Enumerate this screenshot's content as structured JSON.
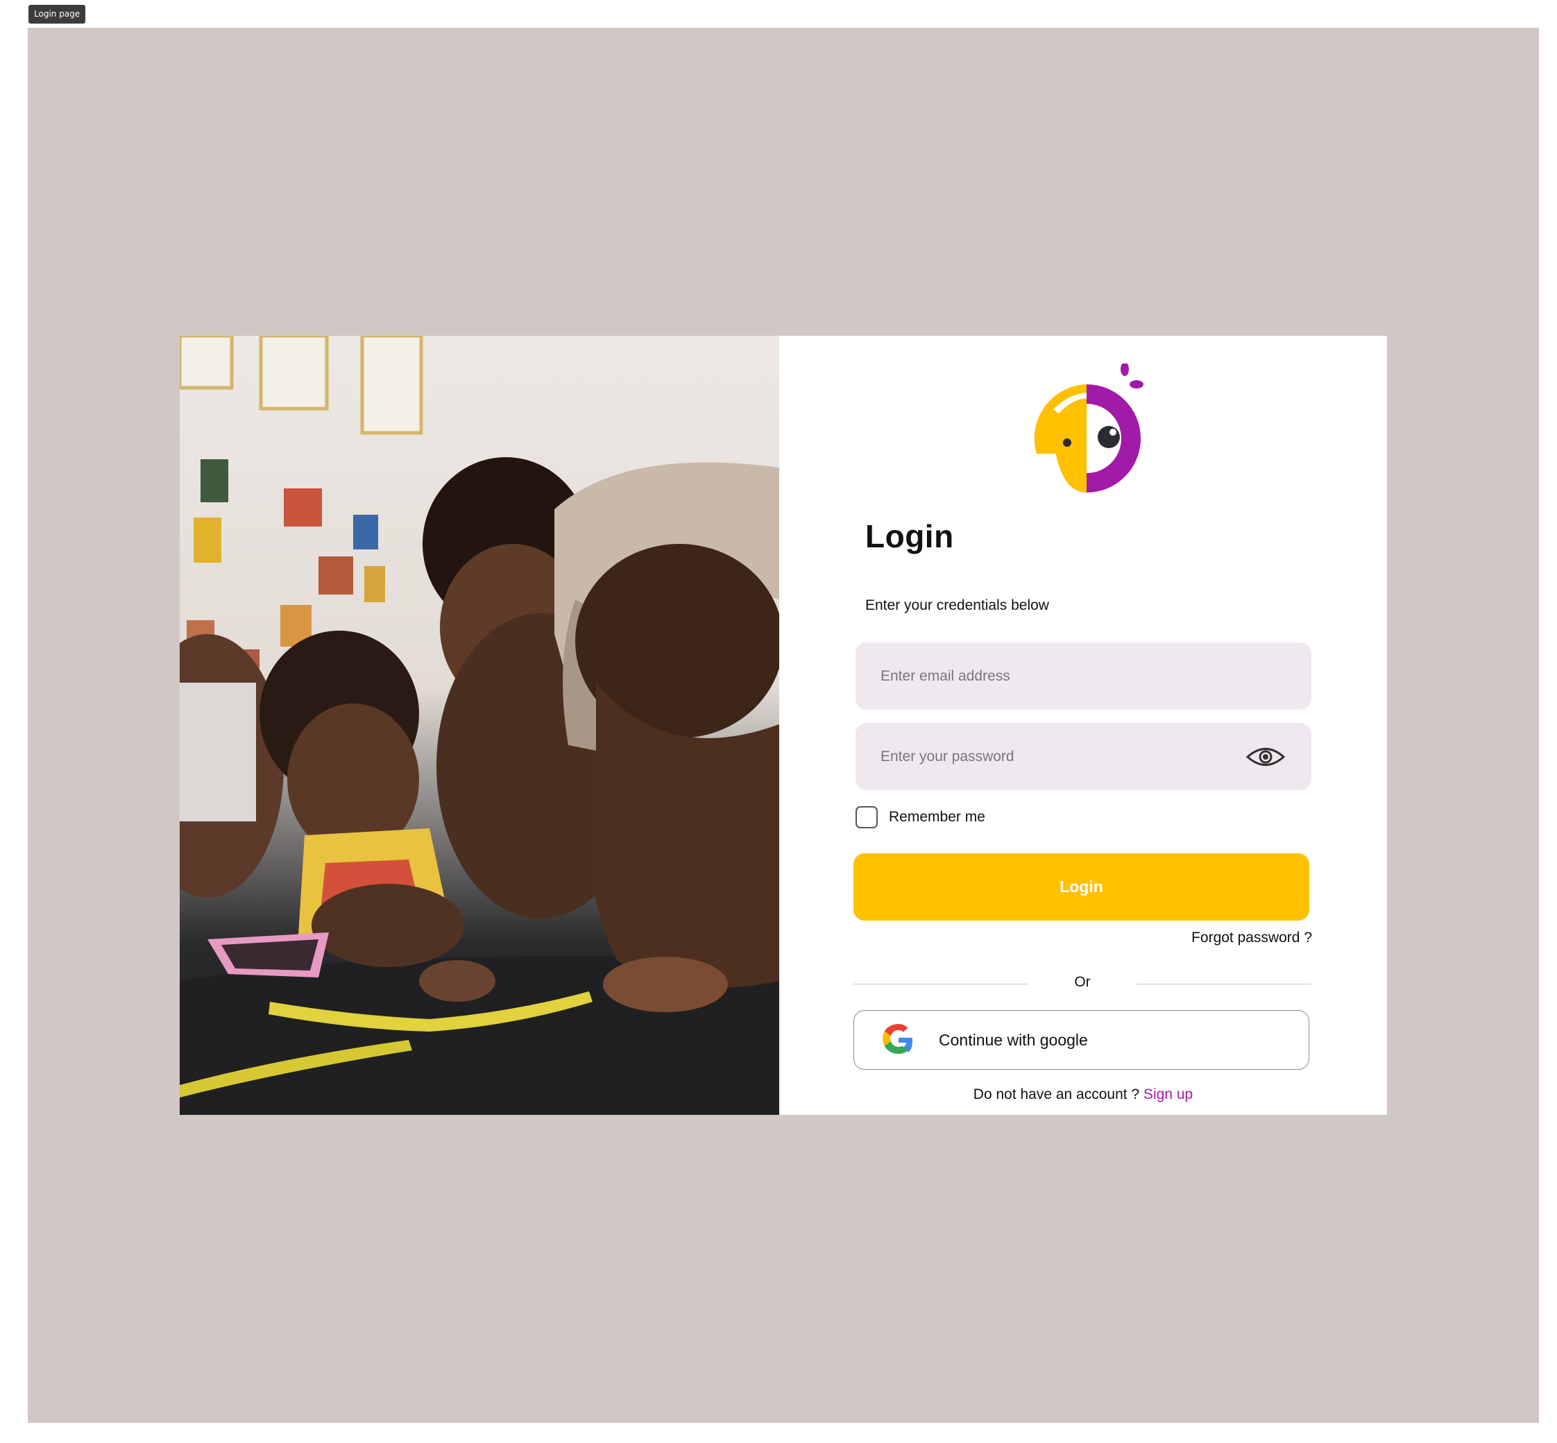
{
  "frame": {
    "label": "Login page"
  },
  "colors": {
    "canvas_bg": "#d1c7c5",
    "accent_yellow": "#ffc000",
    "accent_purple": "#a11aa8",
    "input_bg": "#efe9ef"
  },
  "brand": {
    "logo_icon": "parrot-logo-icon"
  },
  "login": {
    "title": "Login",
    "subtitle": "Enter your credentials below",
    "email_placeholder": "Enter email address",
    "password_placeholder": "Enter your password",
    "password_toggle_icon": "eye-icon",
    "remember_label": "Remember me",
    "remember_checked": false,
    "login_button": "Login",
    "forgot_password": "Forgot password ?",
    "divider_text": "Or",
    "google_icon": "google-icon",
    "google_button": "Continue with google",
    "signup_prompt": "Do not have an account ?",
    "signup_link": "Sign up"
  }
}
